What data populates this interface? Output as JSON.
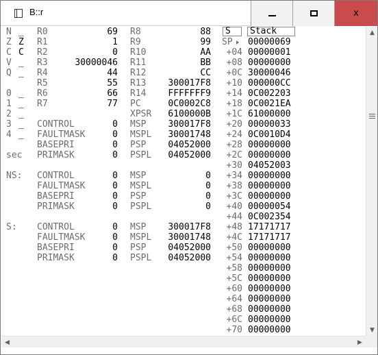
{
  "window": {
    "title": "B::r",
    "min_label": "—",
    "max_label": "☐",
    "close_label": "x"
  },
  "flags": [
    {
      "name": "N",
      "val": "_"
    },
    {
      "name": "Z",
      "val": "Z"
    },
    {
      "name": "C",
      "val": "C"
    },
    {
      "name": "V",
      "val": "_"
    },
    {
      "name": "Q",
      "val": "_"
    },
    {
      "name": "",
      "val": ""
    },
    {
      "name": "0",
      "val": "_"
    },
    {
      "name": "1",
      "val": "_"
    },
    {
      "name": "2",
      "val": "_"
    },
    {
      "name": "3",
      "val": "_"
    },
    {
      "name": "4",
      "val": "_"
    },
    {
      "name": "",
      "val": ""
    },
    {
      "name": "sec",
      "val": ""
    }
  ],
  "regs_left": [
    {
      "name": "R0",
      "value": "69"
    },
    {
      "name": "R1",
      "value": "1"
    },
    {
      "name": "R2",
      "value": "0"
    },
    {
      "name": "R3",
      "value": "30000046"
    },
    {
      "name": "R4",
      "value": "44"
    },
    {
      "name": "R5",
      "value": "55"
    },
    {
      "name": "R6",
      "value": "66"
    },
    {
      "name": "R7",
      "value": "77"
    },
    {
      "name": "",
      "value": ""
    },
    {
      "name": "CONTROL",
      "value": "0"
    },
    {
      "name": "FAULTMASK",
      "value": "0"
    },
    {
      "name": "BASEPRI",
      "value": "0"
    },
    {
      "name": "PRIMASK",
      "value": "0"
    }
  ],
  "regs_mid": [
    {
      "name": "R8",
      "value": "88"
    },
    {
      "name": "R9",
      "value": "99"
    },
    {
      "name": "R10",
      "value": "AA"
    },
    {
      "name": "R11",
      "value": "BB"
    },
    {
      "name": "R12",
      "value": "CC"
    },
    {
      "name": "R13",
      "value": "300017F8"
    },
    {
      "name": "R14",
      "value": "FFFFFFF9"
    },
    {
      "name": "PC",
      "value": "0C0002C8"
    },
    {
      "name": "XPSR",
      "value": "6100000B"
    },
    {
      "name": "MSP",
      "value": "300017F8"
    },
    {
      "name": "MSPL",
      "value": "30001748"
    },
    {
      "name": "PSP",
      "value": "04052000"
    },
    {
      "name": "PSPL",
      "value": "04052000"
    }
  ],
  "ns": {
    "label": "NS:",
    "left": [
      {
        "name": "CONTROL",
        "value": "0"
      },
      {
        "name": "FAULTMASK",
        "value": "0"
      },
      {
        "name": "BASEPRI",
        "value": "0"
      },
      {
        "name": "PRIMASK",
        "value": "0"
      }
    ],
    "mid": [
      {
        "name": "MSP",
        "value": "0"
      },
      {
        "name": "MSPL",
        "value": "0"
      },
      {
        "name": "PSP",
        "value": "0"
      },
      {
        "name": "PSPL",
        "value": "0"
      }
    ]
  },
  "s": {
    "label": "S:",
    "left": [
      {
        "name": "CONTROL",
        "value": "0"
      },
      {
        "name": "FAULTMASK",
        "value": "0"
      },
      {
        "name": "BASEPRI",
        "value": "0"
      },
      {
        "name": "PRIMASK",
        "value": "0"
      }
    ],
    "mid": [
      {
        "name": "MSP",
        "value": "300017F8"
      },
      {
        "name": "MSPL",
        "value": "30001748"
      },
      {
        "name": "PSP",
        "value": "04052000"
      },
      {
        "name": "PSPL",
        "value": "04052000"
      }
    ]
  },
  "stack": {
    "col_header_s": "S",
    "col_header_stack": "Stack",
    "rows": [
      {
        "off": "SP",
        "val": "00000069"
      },
      {
        "off": "+04",
        "val": "00000001"
      },
      {
        "off": "+08",
        "val": "00000000"
      },
      {
        "off": "+0C",
        "val": "30000046"
      },
      {
        "off": "+10",
        "val": "000000CC"
      },
      {
        "off": "+14",
        "val": "0C002203"
      },
      {
        "off": "+18",
        "val": "0C0021EA"
      },
      {
        "off": "+1C",
        "val": "61000000"
      },
      {
        "off": "+20",
        "val": "00000033"
      },
      {
        "off": "+24",
        "val": "0C0010D4"
      },
      {
        "off": "+28",
        "val": "00000000"
      },
      {
        "off": "+2C",
        "val": "00000000"
      },
      {
        "off": "+30",
        "val": "04052003"
      },
      {
        "off": "+34",
        "val": "00000000"
      },
      {
        "off": "+38",
        "val": "00000000"
      },
      {
        "off": "+3C",
        "val": "00000000"
      },
      {
        "off": "+40",
        "val": "00000054"
      },
      {
        "off": "+44",
        "val": "0C002354"
      },
      {
        "off": "+48",
        "val": "17171717"
      },
      {
        "off": "+4C",
        "val": "17171717"
      },
      {
        "off": "+50",
        "val": "00000000"
      },
      {
        "off": "+54",
        "val": "00000000"
      },
      {
        "off": "+58",
        "val": "00000000"
      },
      {
        "off": "+5C",
        "val": "00000000"
      },
      {
        "off": "+60",
        "val": "00000000"
      },
      {
        "off": "+64",
        "val": "00000000"
      },
      {
        "off": "+68",
        "val": "00000000"
      },
      {
        "off": "+6C",
        "val": "00000000"
      },
      {
        "off": "+70",
        "val": "00000000"
      }
    ]
  },
  "scroll": {
    "up": "▲",
    "down": "▼",
    "left": "◀",
    "right": "▶"
  }
}
